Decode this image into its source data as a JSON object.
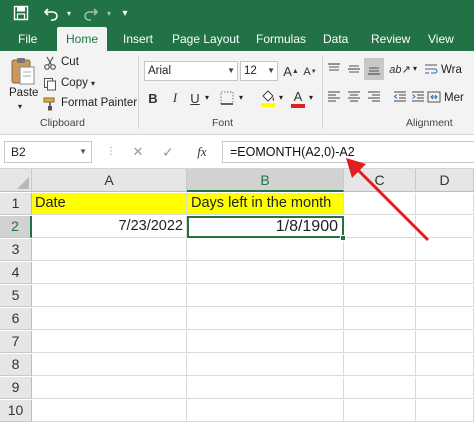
{
  "tabs": [
    "File",
    "Home",
    "Insert",
    "Page Layout",
    "Formulas",
    "Data",
    "Review",
    "View"
  ],
  "clipboard": {
    "paste": "Paste",
    "cut": "Cut",
    "copy": "Copy",
    "format_painter": "Format Painter",
    "group_label": "Clipboard"
  },
  "font": {
    "name": "Arial",
    "size": "12",
    "bold": "B",
    "italic": "I",
    "underline": "U",
    "font_color_glyph": "A",
    "group_label": "Font"
  },
  "alignment": {
    "wrap": "Wra",
    "merge": "Mer",
    "group_label": "Alignment"
  },
  "formula_bar": {
    "name_box": "B2",
    "cancel_glyph": "✕",
    "enter_glyph": "✓",
    "fx": "fx",
    "formula": "=EOMONTH(A2,0)-A2"
  },
  "grid": {
    "columns": [
      "A",
      "B",
      "C",
      "D"
    ],
    "rows": [
      "1",
      "2",
      "3",
      "4",
      "5",
      "6",
      "7",
      "8",
      "9",
      "10"
    ],
    "cells": {
      "A1": "Date",
      "B1": "Days left in the month",
      "A2": "7/23/2022",
      "B2": "1/8/1900"
    },
    "selected_cell": "B2"
  },
  "colors": {
    "excel_green": "#217346",
    "header_fill": "#ffff00",
    "arrow": "#e02020"
  }
}
